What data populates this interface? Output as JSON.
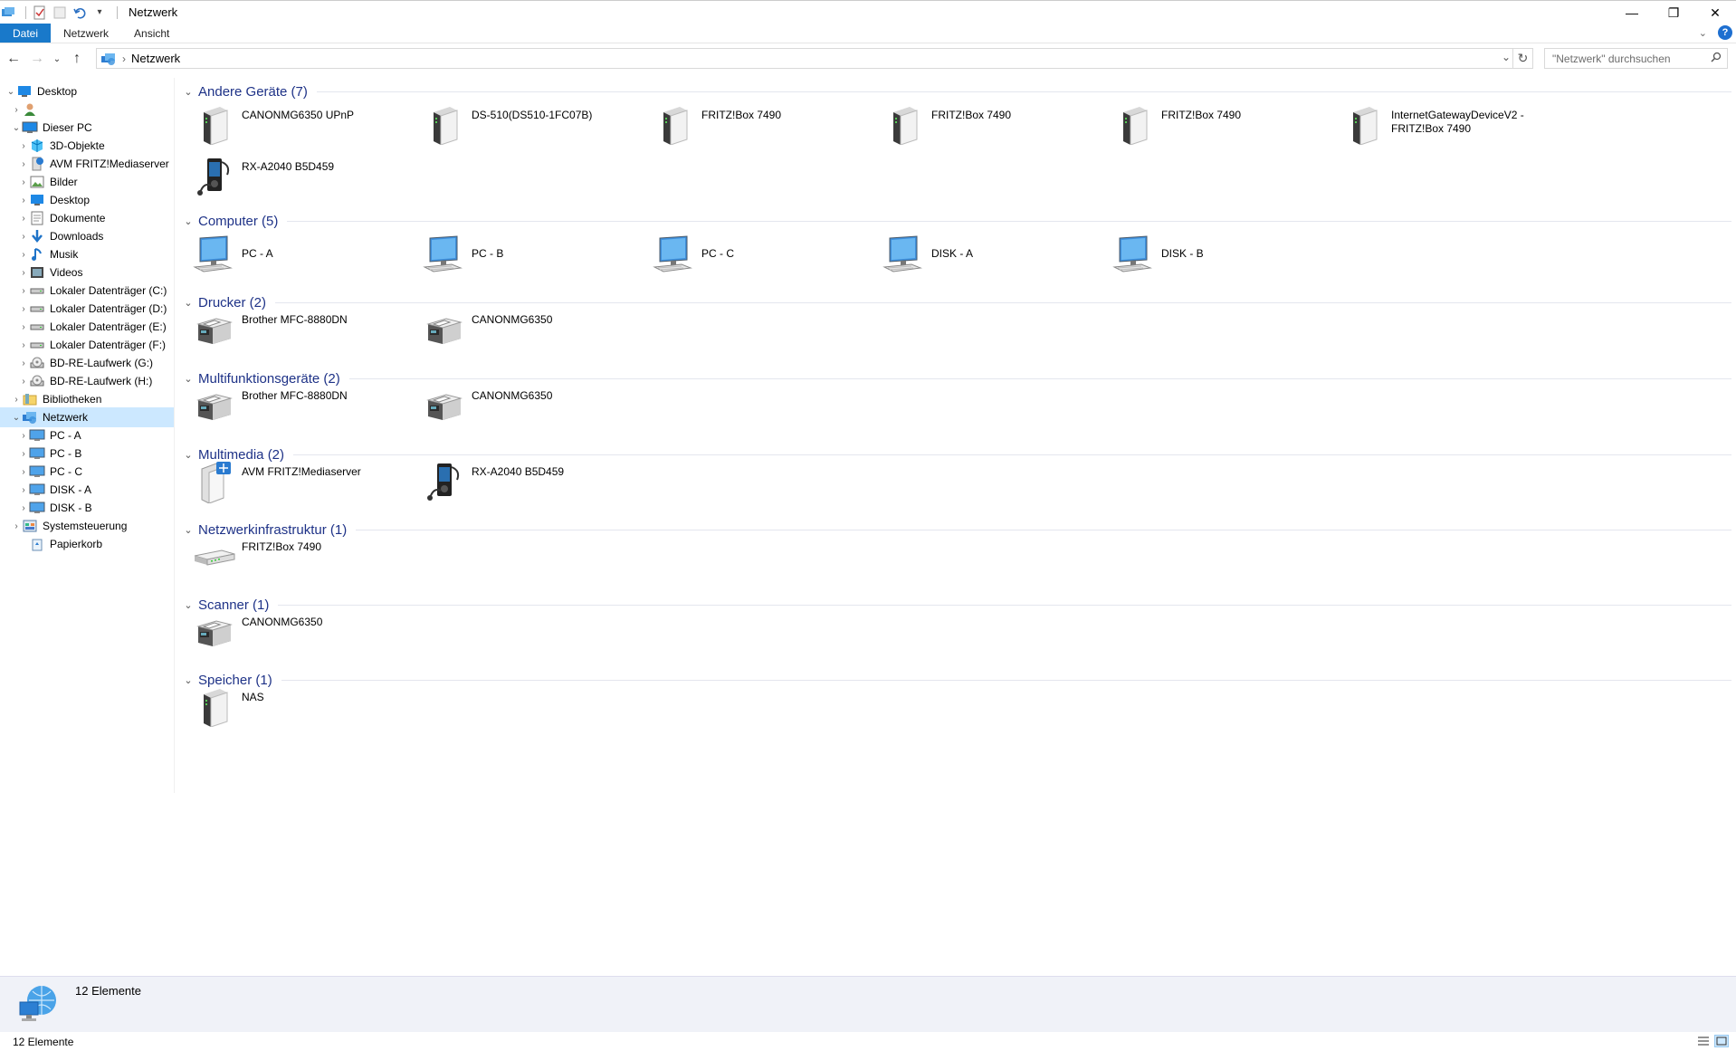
{
  "window": {
    "title": "Netzwerk"
  },
  "ribbon": {
    "tabs": [
      "Datei",
      "Netzwerk",
      "Ansicht"
    ]
  },
  "address": {
    "crumb": "Netzwerk",
    "search_placeholder": "\"Netzwerk\" durchsuchen"
  },
  "nav": {
    "items": [
      {
        "label": "Desktop",
        "icon": "desktop-icon"
      },
      {
        "label": "",
        "icon": "user-icon"
      },
      {
        "label": "Dieser PC",
        "icon": "pc-icon"
      },
      {
        "label": "3D-Objekte",
        "icon": "3d-objects-icon"
      },
      {
        "label": "AVM FRITZ!Mediaserver",
        "icon": "media-server-icon"
      },
      {
        "label": "Bilder",
        "icon": "pictures-icon"
      },
      {
        "label": "Desktop",
        "icon": "desktop-icon"
      },
      {
        "label": "Dokumente",
        "icon": "documents-icon"
      },
      {
        "label": "Downloads",
        "icon": "downloads-icon"
      },
      {
        "label": "Musik",
        "icon": "music-icon"
      },
      {
        "label": "Videos",
        "icon": "videos-icon"
      },
      {
        "label": "Lokaler Datenträger (C:)",
        "icon": "drive-icon"
      },
      {
        "label": "Lokaler Datenträger (D:)",
        "icon": "drive-icon"
      },
      {
        "label": "Lokaler Datenträger (E:)",
        "icon": "drive-icon"
      },
      {
        "label": "Lokaler Datenträger (F:)",
        "icon": "drive-icon"
      },
      {
        "label": "BD-RE-Laufwerk (G:)",
        "icon": "optical-drive-icon"
      },
      {
        "label": "BD-RE-Laufwerk (H:)",
        "icon": "optical-drive-icon"
      },
      {
        "label": "Bibliotheken",
        "icon": "libraries-icon"
      },
      {
        "label": "Netzwerk",
        "icon": "network-icon"
      },
      {
        "label": "PC - A",
        "icon": "computer-icon"
      },
      {
        "label": "PC - B",
        "icon": "computer-icon"
      },
      {
        "label": "PC - C",
        "icon": "computer-icon"
      },
      {
        "label": "DISK - A",
        "icon": "computer-icon"
      },
      {
        "label": "DISK - B",
        "icon": "computer-icon"
      },
      {
        "label": "Systemsteuerung",
        "icon": "control-panel-icon"
      },
      {
        "label": "Papierkorb",
        "icon": "recycle-bin-icon"
      }
    ]
  },
  "groups": [
    {
      "title": "Andere Geräte (7)",
      "items": [
        {
          "label": "CANONMG6350 UPnP",
          "icon": "device-tower-icon"
        },
        {
          "label": "DS-510(DS510-1FC07B)",
          "icon": "device-tower-icon"
        },
        {
          "label": "FRITZ!Box 7490",
          "icon": "device-tower-icon"
        },
        {
          "label": "FRITZ!Box 7490",
          "icon": "device-tower-icon"
        },
        {
          "label": "FRITZ!Box 7490",
          "icon": "device-tower-icon"
        },
        {
          "label": "InternetGatewayDeviceV2 - FRITZ!Box 7490",
          "icon": "device-tower-icon"
        },
        {
          "label": "RX-A2040 B5D459",
          "icon": "media-player-icon"
        }
      ]
    },
    {
      "title": "Computer (5)",
      "items": [
        {
          "label": "PC - A",
          "icon": "computer-icon"
        },
        {
          "label": "PC - B",
          "icon": "computer-icon"
        },
        {
          "label": "PC - C",
          "icon": "computer-icon"
        },
        {
          "label": "DISK - A",
          "icon": "computer-icon"
        },
        {
          "label": "DISK - B",
          "icon": "computer-icon"
        }
      ]
    },
    {
      "title": "Drucker (2)",
      "items": [
        {
          "label": "Brother MFC-8880DN",
          "icon": "printer-icon"
        },
        {
          "label": "CANONMG6350",
          "icon": "printer-icon"
        }
      ]
    },
    {
      "title": "Multifunktionsgeräte (2)",
      "items": [
        {
          "label": "Brother MFC-8880DN",
          "icon": "printer-icon"
        },
        {
          "label": "CANONMG6350",
          "icon": "printer-icon"
        }
      ]
    },
    {
      "title": "Multimedia (2)",
      "items": [
        {
          "label": "AVM FRITZ!Mediaserver",
          "icon": "media-server-icon"
        },
        {
          "label": "RX-A2040 B5D459",
          "icon": "media-player-icon"
        }
      ]
    },
    {
      "title": "Netzwerkinfrastruktur (1)",
      "items": [
        {
          "label": "FRITZ!Box 7490",
          "icon": "router-icon"
        }
      ]
    },
    {
      "title": "Scanner (1)",
      "items": [
        {
          "label": "CANONMG6350",
          "icon": "printer-icon"
        }
      ]
    },
    {
      "title": "Speicher (1)",
      "items": [
        {
          "label": "NAS",
          "icon": "device-tower-icon"
        }
      ]
    }
  ],
  "details": {
    "count_text": "12 Elemente"
  },
  "status": {
    "count_text": "12 Elemente"
  },
  "colors": {
    "accent": "#1979ca",
    "group_title": "#1e3287",
    "selected": "#cce8ff"
  }
}
